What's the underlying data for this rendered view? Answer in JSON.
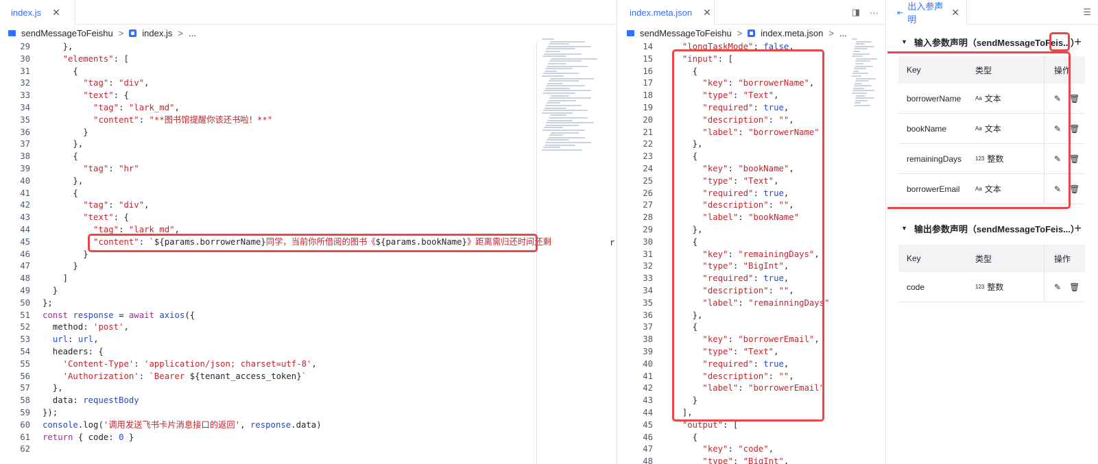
{
  "left_editor": {
    "tab_label": "index.js",
    "breadcrumb": {
      "folder": "sendMessageToFeishu",
      "file": "index.js",
      "more": "..."
    },
    "lines": [
      {
        "n": "29",
        "text": "    },"
      },
      {
        "n": "30",
        "text": "    \"elements\": ["
      },
      {
        "n": "31",
        "text": "      {"
      },
      {
        "n": "32",
        "text": "        \"tag\": \"div\","
      },
      {
        "n": "33",
        "text": "        \"text\": {"
      },
      {
        "n": "34",
        "text": "          \"tag\": \"lark_md\","
      },
      {
        "n": "35",
        "text": "          \"content\": \"**图书馆提醒你该还书啦！**\""
      },
      {
        "n": "36",
        "text": "        }"
      },
      {
        "n": "37",
        "text": "      },"
      },
      {
        "n": "38",
        "text": "      {"
      },
      {
        "n": "39",
        "text": "        \"tag\": \"hr\""
      },
      {
        "n": "40",
        "text": "      },"
      },
      {
        "n": "41",
        "text": "      {"
      },
      {
        "n": "42",
        "text": "        \"tag\": \"div\","
      },
      {
        "n": "43",
        "text": "        \"text\": {"
      },
      {
        "n": "44",
        "text": "          \"tag\": \"lark_md\","
      },
      {
        "n": "45",
        "text": "          \"content\": `${params.borrowerName}同学，当前你所借阅的图书《${params.bookName}》距离需归还时间还剩"
      },
      {
        "n": "46",
        "text": "        }"
      },
      {
        "n": "47",
        "text": "      }"
      },
      {
        "n": "48",
        "text": "    ]"
      },
      {
        "n": "49",
        "text": "  }"
      },
      {
        "n": "50",
        "text": "};"
      },
      {
        "n": "51",
        "text": "const response = await axios({"
      },
      {
        "n": "52",
        "text": "  method: 'post',"
      },
      {
        "n": "53",
        "text": "  url: url,"
      },
      {
        "n": "54",
        "text": "  headers: {"
      },
      {
        "n": "55",
        "text": "    'Content-Type': 'application/json; charset=utf-8',"
      },
      {
        "n": "56",
        "text": "    'Authorization': `Bearer ${tenant_access_token}`"
      },
      {
        "n": "57",
        "text": "  },"
      },
      {
        "n": "58",
        "text": "  data: requestBody"
      },
      {
        "n": "59",
        "text": "});"
      },
      {
        "n": "60",
        "text": "console.log('调用发送飞书卡片消息接口的返回', response.data)"
      },
      {
        "n": "61",
        "text": "return { code: 0 }"
      },
      {
        "n": "62",
        "text": ""
      }
    ],
    "overflow_char": "r"
  },
  "mid_editor": {
    "tab_label": "index.meta.json",
    "breadcrumb": {
      "folder": "sendMessageToFeishu",
      "file": "index.meta.json",
      "more": "..."
    },
    "lines": [
      {
        "n": "14",
        "text": "  \"longTaskMode\": false,"
      },
      {
        "n": "15",
        "text": "  \"input\": ["
      },
      {
        "n": "16",
        "text": "    {"
      },
      {
        "n": "17",
        "text": "      \"key\": \"borrowerName\","
      },
      {
        "n": "18",
        "text": "      \"type\": \"Text\","
      },
      {
        "n": "19",
        "text": "      \"required\": true,"
      },
      {
        "n": "20",
        "text": "      \"description\": \"\","
      },
      {
        "n": "21",
        "text": "      \"label\": \"borrowerName\""
      },
      {
        "n": "22",
        "text": "    },"
      },
      {
        "n": "23",
        "text": "    {"
      },
      {
        "n": "24",
        "text": "      \"key\": \"bookName\","
      },
      {
        "n": "25",
        "text": "      \"type\": \"Text\","
      },
      {
        "n": "26",
        "text": "      \"required\": true,"
      },
      {
        "n": "27",
        "text": "      \"description\": \"\","
      },
      {
        "n": "28",
        "text": "      \"label\": \"bookName\""
      },
      {
        "n": "29",
        "text": "    },"
      },
      {
        "n": "30",
        "text": "    {"
      },
      {
        "n": "31",
        "text": "      \"key\": \"remainingDays\","
      },
      {
        "n": "32",
        "text": "      \"type\": \"BigInt\","
      },
      {
        "n": "33",
        "text": "      \"required\": true,"
      },
      {
        "n": "34",
        "text": "      \"description\": \"\","
      },
      {
        "n": "35",
        "text": "      \"label\": \"remainningDays\""
      },
      {
        "n": "36",
        "text": "    },"
      },
      {
        "n": "37",
        "text": "    {"
      },
      {
        "n": "38",
        "text": "      \"key\": \"borrowerEmail\","
      },
      {
        "n": "39",
        "text": "      \"type\": \"Text\","
      },
      {
        "n": "40",
        "text": "      \"required\": true,"
      },
      {
        "n": "41",
        "text": "      \"description\": \"\","
      },
      {
        "n": "42",
        "text": "      \"label\": \"borrowerEmail\""
      },
      {
        "n": "43",
        "text": "    }"
      },
      {
        "n": "44",
        "text": "  ],"
      },
      {
        "n": "45",
        "text": "  \"output\": ["
      },
      {
        "n": "46",
        "text": "    {"
      },
      {
        "n": "47",
        "text": "      \"key\": \"code\","
      },
      {
        "n": "48",
        "text": "      \"type\": \"BigInt\","
      }
    ]
  },
  "right_panel": {
    "tab_label": "出入参声明",
    "input_section": {
      "title": "输入参数声明（sendMessageToFeis...）",
      "headers": {
        "key": "Key",
        "type": "类型",
        "op": "操作"
      },
      "rows": [
        {
          "key": "borrowerName",
          "type_icon": "Aa",
          "type": "文本"
        },
        {
          "key": "bookName",
          "type_icon": "Aa",
          "type": "文本"
        },
        {
          "key": "remainingDays",
          "type_icon": "123",
          "type": "整数"
        },
        {
          "key": "borrowerEmail",
          "type_icon": "Aa",
          "type": "文本"
        }
      ]
    },
    "output_section": {
      "title": "输出参数声明（sendMessageToFeis...）",
      "headers": {
        "key": "Key",
        "type": "类型",
        "op": "操作"
      },
      "rows": [
        {
          "key": "code",
          "type_icon": "123",
          "type": "整数"
        }
      ]
    }
  },
  "colors": {
    "accent": "#3370ff",
    "highlight": "#e8474a",
    "string": "#c0262d",
    "keyword": "#a626a4",
    "identifier": "#1f4bd4"
  }
}
